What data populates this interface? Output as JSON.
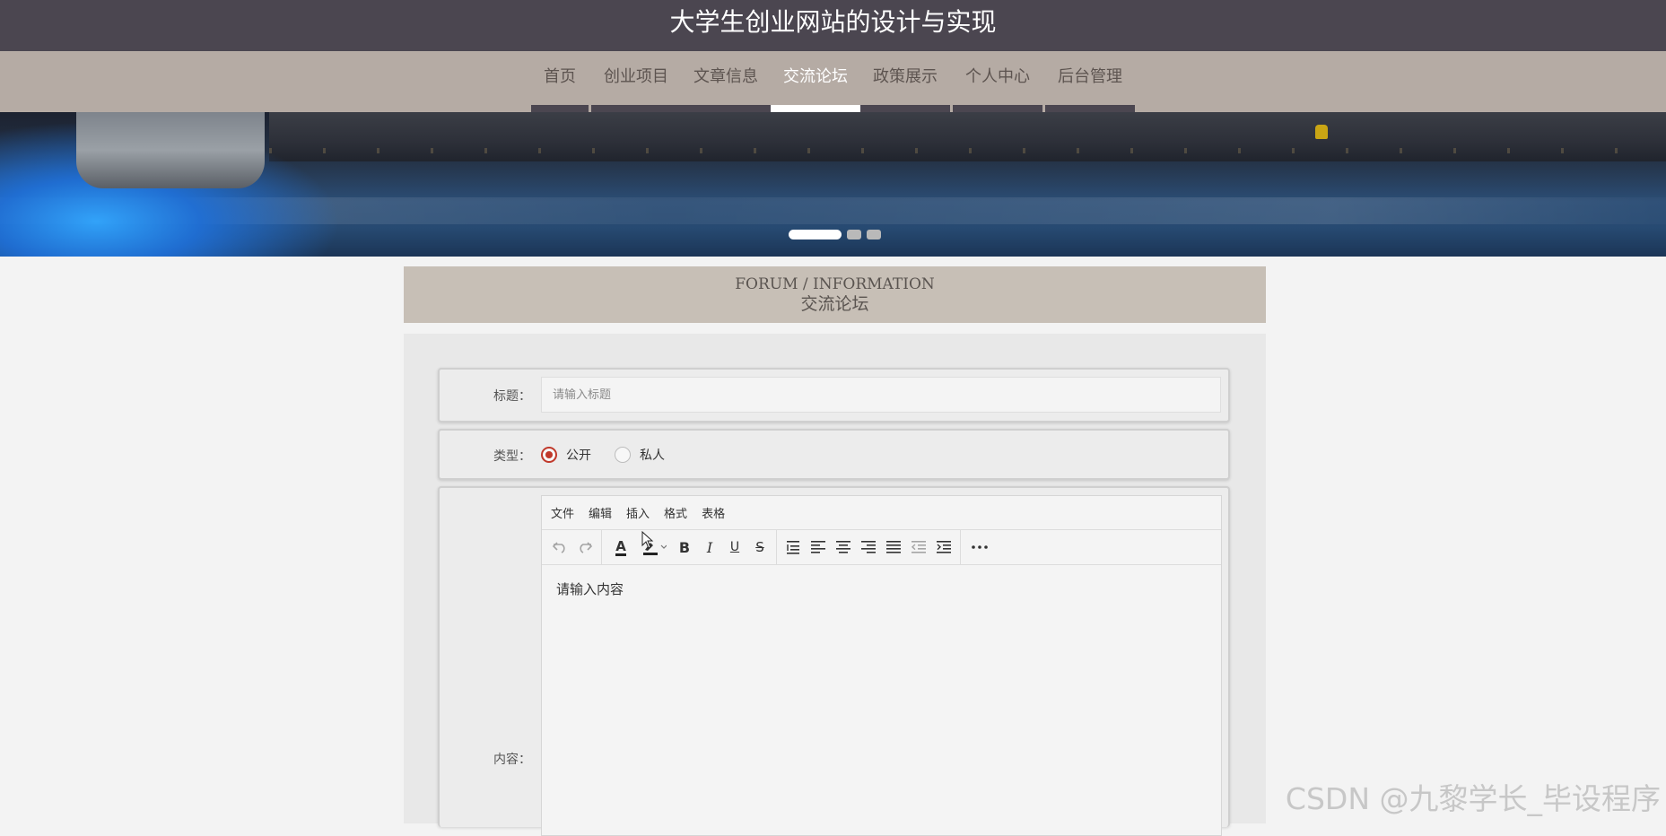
{
  "site": {
    "title": "大学生创业网站的设计与实现"
  },
  "nav": {
    "items": [
      {
        "label": "首页",
        "name": "home"
      },
      {
        "label": "创业项目",
        "name": "startup-projects"
      },
      {
        "label": "文章信息",
        "name": "articles"
      },
      {
        "label": "交流论坛",
        "name": "forum"
      },
      {
        "label": "政策展示",
        "name": "policies"
      },
      {
        "label": "个人中心",
        "name": "personal-center"
      },
      {
        "label": "后台管理",
        "name": "admin"
      }
    ],
    "active": "交流论坛"
  },
  "banner": {
    "slides": 3,
    "active_slide": 1
  },
  "section": {
    "title_en": "FORUM / INFORMATION",
    "title_cn": "交流论坛"
  },
  "form": {
    "title_label": "标题：",
    "title_placeholder": "请输入标题",
    "title_value": "",
    "type_label": "类型：",
    "type_options": [
      "公开",
      "私人"
    ],
    "type_selected": "公开",
    "content_label": "内容：",
    "content_placeholder": "请输入内容"
  },
  "editor": {
    "menu": [
      "文件",
      "编辑",
      "插入",
      "格式",
      "表格"
    ],
    "toolbar_icons": [
      "undo-icon",
      "redo-icon",
      "text-color-icon",
      "highlight-color-icon",
      "bold-icon",
      "italic-icon",
      "underline-icon",
      "strikethrough-icon",
      "line-height-icon",
      "align-left-icon",
      "align-center-icon",
      "align-right-icon",
      "align-justify-icon",
      "outdent-icon",
      "indent-icon",
      "more-icon"
    ],
    "toolbar_labels": {
      "bold": "B",
      "italic": "I",
      "underline": "U",
      "strike": "S",
      "text_color": "A"
    }
  },
  "watermark": "CSDN @九黎学长_毕设程序",
  "colors": {
    "header_bg": "#4b4650",
    "nav_bg": "#b5aba4",
    "section_header_bg": "#c7bfb6",
    "radio_accent": "#c0392b"
  }
}
